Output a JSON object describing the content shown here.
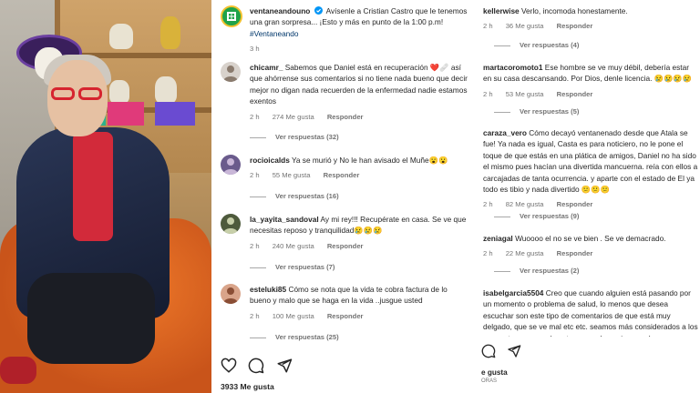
{
  "post": {
    "author": "ventaneandouno",
    "caption": "Avísenle a Cristian Castro que le tenemos una gran sorpresa... ¡Esto y más en punto de la 1:00 p.m!",
    "hashtag": "#Ventaneando",
    "time": "3 h",
    "likes": "3933 Me gusta"
  },
  "comments": [
    {
      "user": "chicamr_",
      "text": "Sabemos que Daniel está en recuperación ❤️🩹 así que ahórrense sus comentarios si no tiene nada bueno que decir mejor no digan nada recuerden de la enfermedad nadie estamos exentos",
      "time": "2 h",
      "likes": "274 Me gusta",
      "reply": "Responder",
      "view_replies": "Ver respuestas (32)"
    },
    {
      "user": "rocioicalds",
      "text": "Ya se murió y No le han avisado el Muñe😮😮",
      "time": "2 h",
      "likes": "55 Me gusta",
      "reply": "Responder",
      "view_replies": "Ver respuestas (16)"
    },
    {
      "user": "la_yayita_sandoval",
      "text": "Ay mi rey!!! Recupérate en casa. Se ve que necesitas reposo y tranquilidad😢😢😢",
      "time": "2 h",
      "likes": "240 Me gusta",
      "reply": "Responder",
      "view_replies": "Ver respuestas (7)"
    },
    {
      "user": "esteluki85",
      "text": "Cómo se nota que la vida te cobra factura de lo bueno y malo que se haga en la vida ..jusgue usted",
      "time": "2 h",
      "likes": "100 Me gusta",
      "reply": "Responder",
      "view_replies": "Ver respuestas (25)"
    }
  ],
  "right_comments": [
    {
      "user": "kellerwise",
      "text": "Verlo, incomoda honestamente.",
      "time": "2 h",
      "likes": "36 Me gusta",
      "reply": "Responder",
      "view_replies": "Ver respuestas (4)"
    },
    {
      "user": "martacoromoto1",
      "text": "Ese hombre se ve muy débil, debería estar en su casa descansando. Por Dios, denle licencia. 😢😢😢😢",
      "time": "2 h",
      "likes": "53 Me gusta",
      "reply": "Responder",
      "view_replies": "Ver respuestas (5)"
    },
    {
      "user": "caraza_vero",
      "text": "Cómo decayó ventanenado desde que Atala se fue! Ya nada es igual, Casta es para noticiero, no le pone el toque de que estás en una plática de amigos, Daniel no ha sido el mismo pues hacían una divertida mancuerna. reía con ellos a carcajadas de tanta ocurrencia. y aparte con el estado de El ya todo es tibio y nada divertido 😕😕😕",
      "time": "2 h",
      "likes": "82 Me gusta",
      "reply": "Responder",
      "view_replies": "Ver respuestas (9)"
    },
    {
      "user": "zeniagal",
      "text": "Wuoooo el no se ve bien . Se ve demacrado.",
      "time": "2 h",
      "likes": "22 Me gusta",
      "reply": "Responder",
      "view_replies": "Ver respuestas (2)"
    },
    {
      "user": "isabelgarcia5504",
      "text": "Creo que cuando alguien está pasando por un momento o problema de salud, lo menos que desea escuchar son este tipo de comentarios de que está muy delgado, que se ve mal etc etc. seamos más considerados a los momentos que puede estar pasando, mejor mandemos",
      "time": "",
      "likes": "",
      "reply": "",
      "view_replies": ""
    }
  ],
  "right_footer": {
    "likes": "e gusta",
    "time": "ORAS"
  },
  "colors": {
    "accent_link": "#00376b",
    "heart_red": "#ff3040",
    "meta_grey": "#737373"
  },
  "icons": [
    "heart-icon",
    "comment-icon",
    "share-icon",
    "verified-icon"
  ]
}
